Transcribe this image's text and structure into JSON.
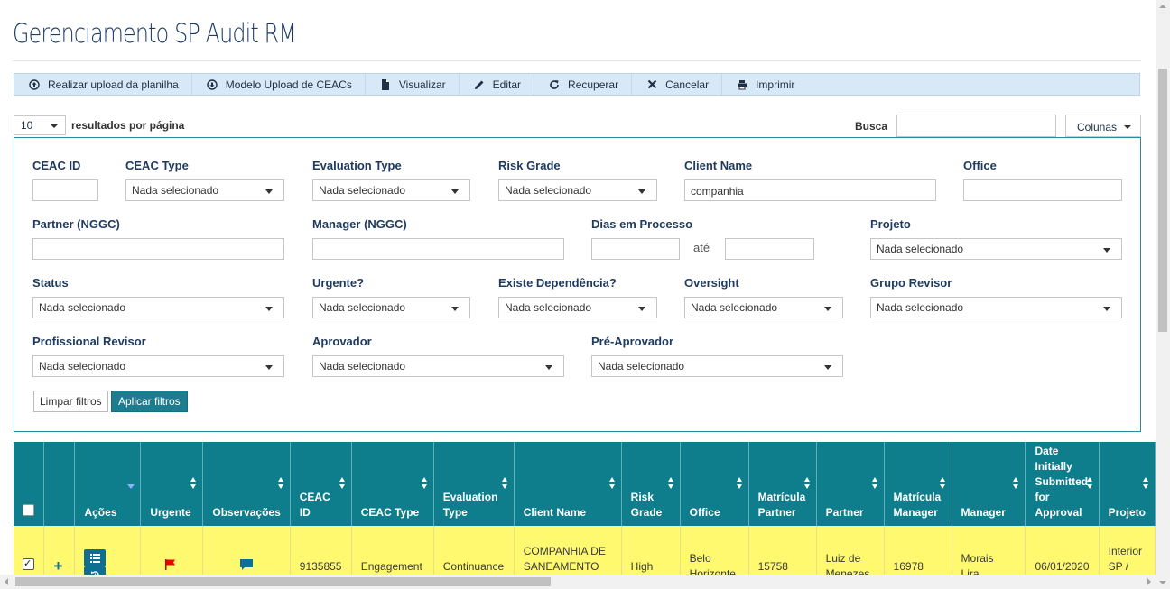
{
  "page": {
    "title": "Gerenciamento SP Audit RM"
  },
  "toolbar": {
    "buttons": [
      {
        "label": "Realizar upload da planilha",
        "icon": "upload-circle-icon"
      },
      {
        "label": "Modelo Upload de CEACs",
        "icon": "download-circle-icon"
      },
      {
        "label": "Visualizar",
        "icon": "file-icon"
      },
      {
        "label": "Editar",
        "icon": "pencil-icon"
      },
      {
        "label": "Recuperar",
        "icon": "refresh-icon"
      },
      {
        "label": "Cancelar",
        "icon": "close-icon"
      },
      {
        "label": "Imprimir",
        "icon": "printer-icon"
      }
    ]
  },
  "list_controls": {
    "page_length": "10",
    "page_length_label": "resultados por página",
    "search_label": "Busca",
    "search_value": "",
    "columns_button": "Colunas"
  },
  "filters": {
    "placeholder_select": "Nada selecionado",
    "ceac_id": {
      "label": "CEAC ID",
      "value": ""
    },
    "ceac_type": {
      "label": "CEAC Type",
      "value": "Nada selecionado"
    },
    "evaluation_type": {
      "label": "Evaluation Type",
      "value": "Nada selecionado"
    },
    "risk_grade": {
      "label": "Risk Grade",
      "value": "Nada selecionado"
    },
    "client_name": {
      "label": "Client Name",
      "value": "companhia"
    },
    "office": {
      "label": "Office",
      "value": ""
    },
    "partner": {
      "label": "Partner (NGGC)",
      "value": ""
    },
    "manager": {
      "label": "Manager (NGGC)",
      "value": ""
    },
    "dias": {
      "label": "Dias em Processo",
      "from": "",
      "to_label": "até",
      "to": ""
    },
    "projeto": {
      "label": "Projeto",
      "value": "Nada selecionado"
    },
    "status": {
      "label": "Status",
      "value": "Nada selecionado"
    },
    "urgente": {
      "label": "Urgente?",
      "value": "Nada selecionado"
    },
    "dependencia": {
      "label": "Existe Dependência?",
      "value": "Nada selecionado"
    },
    "oversight": {
      "label": "Oversight",
      "value": "Nada selecionado"
    },
    "grupo_revisor": {
      "label": "Grupo Revisor",
      "value": "Nada selecionado"
    },
    "profissional_revisor": {
      "label": "Profissional Revisor",
      "value": "Nada selecionado"
    },
    "aprovador": {
      "label": "Aprovador",
      "value": "Nada selecionado"
    },
    "pre_aprovador": {
      "label": "Pré-Aprovador",
      "value": "Nada selecionado"
    },
    "clear_button": "Limpar filtros",
    "apply_button": "Aplicar filtros"
  },
  "table": {
    "headers": [
      "Ações",
      "Urgente",
      "Observações",
      "CEAC ID",
      "CEAC Type",
      "Evaluation Type",
      "Client Name",
      "Risk Grade",
      "Office",
      "Matrícula Partner",
      "Partner",
      "Matrícula Manager",
      "Manager",
      "Date Initially Submitted for Approval",
      "Projeto"
    ],
    "rows": [
      {
        "selected": true,
        "urgent_icon": "red-flag-icon",
        "observation_icon": "comment-icon",
        "ceac_id": "9135855",
        "ceac_type": "Engagement",
        "evaluation_type": "Continuance",
        "client_name": "COMPANHIA DE SANEAMENTO DE MINAS",
        "risk_grade": "High",
        "office": "Belo Horizonte",
        "matricula_partner": "15758",
        "partner": "Luiz de Menezes,",
        "matricula_manager": "16978",
        "manager": "Morais Lira,",
        "date_submitted": "06/01/2020",
        "projeto": "Interior SP / MG /"
      }
    ]
  },
  "colors": {
    "header_teal": "#0e7d8c",
    "row_highlight": "#fef96e",
    "toolbar_bg": "#d7e9f7",
    "apply_button": "#1d7d8f"
  }
}
